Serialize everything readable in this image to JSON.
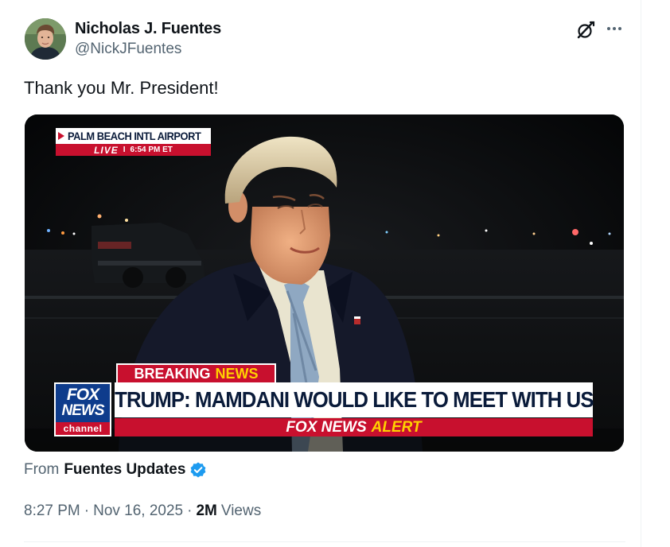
{
  "tweet": {
    "author_name": "Nicholas J. Fuentes",
    "author_handle": "@NickJFuentes",
    "text": "Thank you Mr. President!",
    "source_prefix": "From",
    "source_name": "Fuentes Updates",
    "time": "8:27 PM",
    "date": "Nov 16, 2025",
    "separator": "·",
    "views_count": "2M",
    "views_label": "Views"
  },
  "actions": {
    "grok_icon": "grok-icon",
    "more_icon": "more-icon",
    "more_label": "···"
  },
  "video": {
    "location": "PALM BEACH INTL AIRPORT",
    "live_label": "LIVE",
    "live_separator": "I",
    "time": "6:54 PM ET",
    "breaking_word": "BREAKING",
    "news_word": "NEWS",
    "logo_top": "FOX",
    "logo_mid": "NEWS",
    "logo_channel": "channel",
    "headline": "TRUMP: MAMDANI WOULD LIKE TO MEET WITH US",
    "alert_brand": "FOX NEWS",
    "alert_word": "ALERT"
  },
  "colors": {
    "text_primary": "#0f1419",
    "text_secondary": "#536471",
    "verified_blue": "#1d9bf0",
    "fox_red": "#c8102e",
    "fox_blue": "#0e3c8c",
    "fox_yellow": "#ffd100"
  }
}
